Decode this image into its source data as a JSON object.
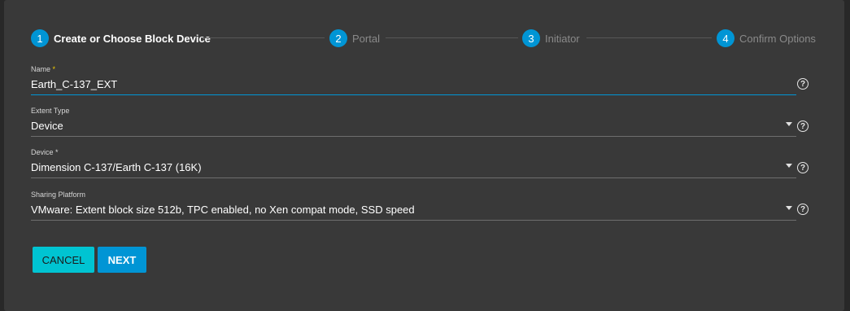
{
  "stepper": {
    "steps": [
      {
        "number": "1",
        "label": "Create or Choose Block Device",
        "active": true
      },
      {
        "number": "2",
        "label": "Portal",
        "active": false
      },
      {
        "number": "3",
        "label": "Initiator",
        "active": false
      },
      {
        "number": "4",
        "label": "Confirm Options",
        "active": false
      }
    ]
  },
  "form": {
    "name": {
      "label": "Name",
      "required_mark": "*",
      "value": "Earth_C-137_EXT"
    },
    "extent_type": {
      "label": "Extent Type",
      "value": "Device"
    },
    "device": {
      "label": "Device",
      "required_mark": "*",
      "value": "Dimension C-137/Earth C-137 (16K)"
    },
    "sharing_platform": {
      "label": "Sharing Platform",
      "value": "VMware: Extent block size 512b, TPC enabled, no Xen compat mode, SSD speed"
    },
    "help_glyph": "?"
  },
  "actions": {
    "cancel_label": "CANCEL",
    "next_label": "NEXT"
  },
  "colors": {
    "background": "#282828",
    "card": "#393939",
    "accent_blue": "#0095d5",
    "accent_cyan": "#00c4d2",
    "required_star": "#f0cb00"
  }
}
